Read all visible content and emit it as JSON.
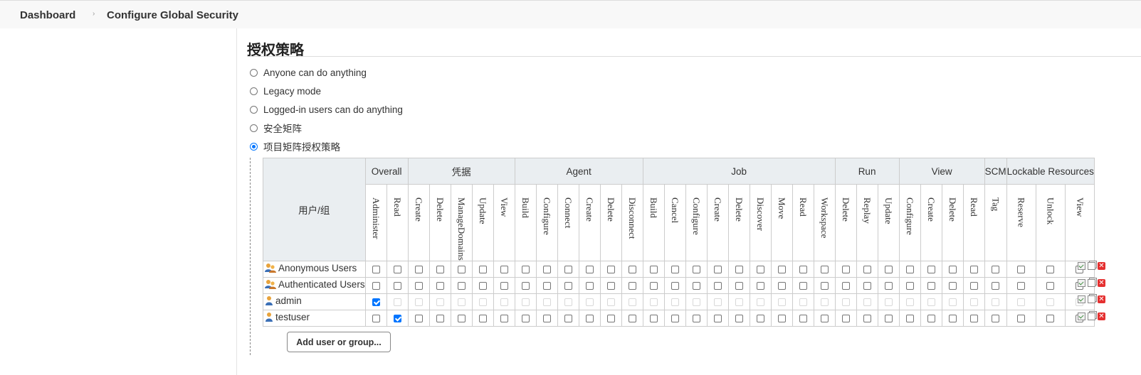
{
  "breadcrumb": {
    "items": [
      "Dashboard",
      "Configure Global Security"
    ],
    "separator": "›"
  },
  "section": {
    "title": "授权策略"
  },
  "strategies": [
    {
      "label": "Anyone can do anything",
      "selected": false
    },
    {
      "label": "Legacy mode",
      "selected": false
    },
    {
      "label": "Logged-in users can do anything",
      "selected": false
    },
    {
      "label": "安全矩阵",
      "selected": false
    },
    {
      "label": "项目矩阵授权策略",
      "selected": true
    }
  ],
  "matrix": {
    "user_header": "用户/组",
    "groups": [
      {
        "name": "Overall",
        "permissions": [
          "Administer",
          "Read"
        ]
      },
      {
        "name": "凭据",
        "permissions": [
          "Create",
          "Delete",
          "ManageDomains",
          "Update",
          "View"
        ]
      },
      {
        "name": "Agent",
        "permissions": [
          "Build",
          "Configure",
          "Connect",
          "Create",
          "Delete",
          "Disconnect"
        ]
      },
      {
        "name": "Job",
        "permissions": [
          "Build",
          "Cancel",
          "Configure",
          "Create",
          "Delete",
          "Discover",
          "Move",
          "Read",
          "Workspace"
        ]
      },
      {
        "name": "Run",
        "permissions": [
          "Delete",
          "Replay",
          "Update"
        ]
      },
      {
        "name": "View",
        "permissions": [
          "Configure",
          "Create",
          "Delete",
          "Read"
        ]
      },
      {
        "name": "SCM",
        "permissions": [
          "Tag"
        ]
      },
      {
        "name": "Lockable Resources",
        "permissions": [
          "Reserve",
          "Unlock",
          "View"
        ]
      }
    ],
    "rows": [
      {
        "name": "Anonymous Users",
        "icon": "user-group-icon",
        "checked": [],
        "disabled": false
      },
      {
        "name": "Authenticated Users",
        "icon": "user-group-icon",
        "checked": [],
        "disabled": false
      },
      {
        "name": "admin",
        "icon": "user-icon",
        "checked": [
          0
        ],
        "disabled": true
      },
      {
        "name": "testuser",
        "icon": "user-icon",
        "checked": [
          1
        ],
        "disabled": false
      }
    ]
  },
  "add_button": {
    "label": "Add user or group..."
  }
}
